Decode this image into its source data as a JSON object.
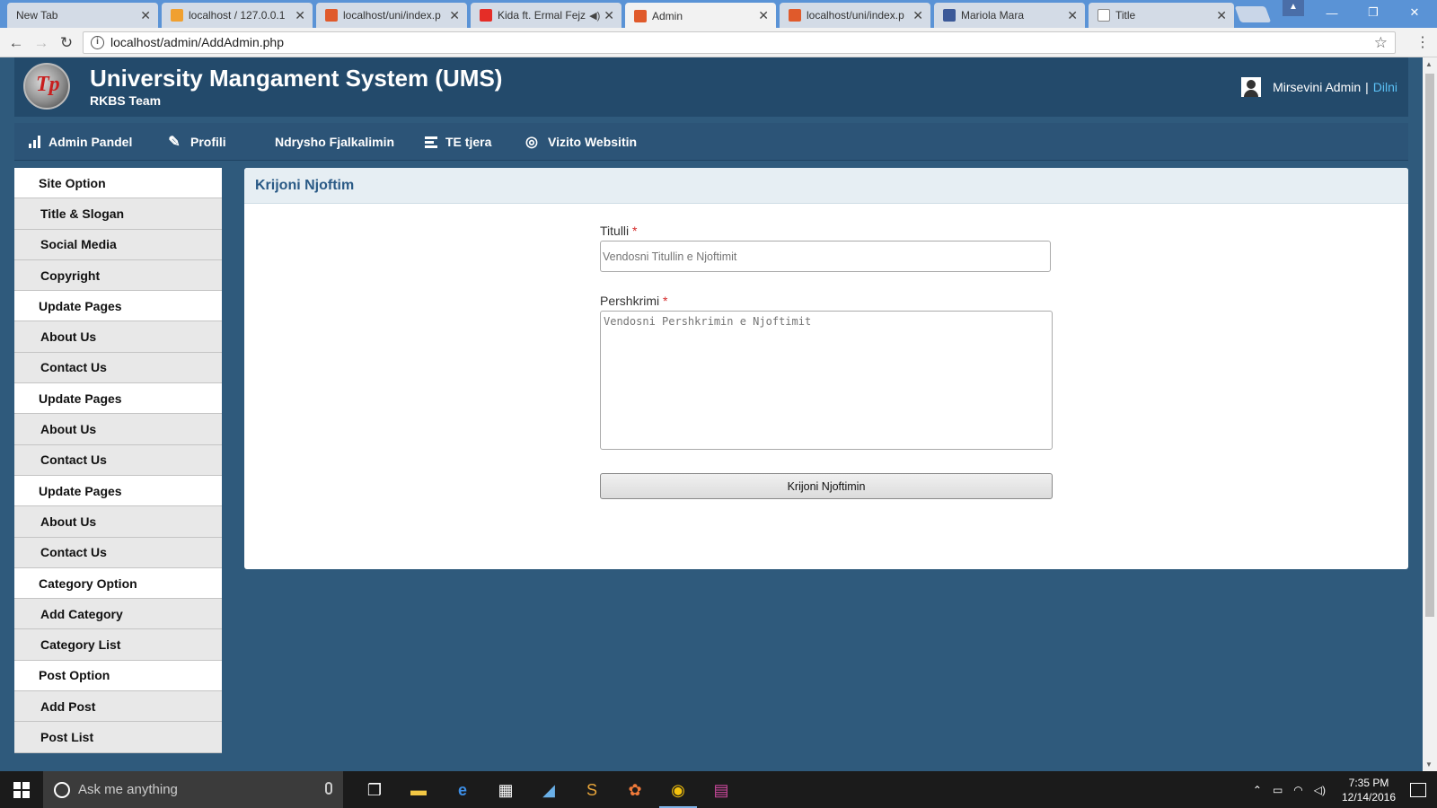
{
  "browser": {
    "tabs": [
      {
        "label": "New Tab",
        "favicon_color": "#d3dbe6",
        "active": false
      },
      {
        "label": "localhost / 127.0.0.1",
        "favicon_color": "#f0a030",
        "active": false
      },
      {
        "label": "localhost/uni/index.p",
        "favicon_color": "#e05a2b",
        "active": false
      },
      {
        "label": "Kida ft. Ermal Fejz",
        "favicon_color": "#e52d27",
        "active": false
      },
      {
        "label": "Admin",
        "favicon_color": "#e05a2b",
        "active": true
      },
      {
        "label": "localhost/uni/index.p",
        "favicon_color": "#e05a2b",
        "active": false
      },
      {
        "label": "Mariola Mara",
        "favicon_color": "#3b5998",
        "active": false
      },
      {
        "label": "Title",
        "favicon_color": "#ffffff",
        "active": false
      }
    ],
    "url": "localhost/admin/AddAdmin.php"
  },
  "header": {
    "title": "University Mangament System (UMS)",
    "subtitle": "RKBS Team",
    "greeting": "Mirsevini Admin",
    "separator": "|",
    "logout": "Dilni"
  },
  "topnav": {
    "items": [
      {
        "label": "Admin Pandel",
        "icon": "bar-chart-icon"
      },
      {
        "label": "Profili",
        "icon": "edit-icon"
      },
      {
        "label": "Ndrysho Fjalkalimin",
        "icon": "none"
      },
      {
        "label": "TE tjera",
        "icon": "list-icon"
      },
      {
        "label": "Vizito Websitin",
        "icon": "globe-icon"
      }
    ]
  },
  "sidebar": {
    "items": [
      {
        "label": "Site Option",
        "type": "header"
      },
      {
        "label": "Title & Slogan",
        "type": "link"
      },
      {
        "label": "Social Media",
        "type": "link"
      },
      {
        "label": "Copyright",
        "type": "link"
      },
      {
        "label": "Update Pages",
        "type": "header"
      },
      {
        "label": "About Us",
        "type": "link"
      },
      {
        "label": "Contact Us",
        "type": "link"
      },
      {
        "label": "Update Pages",
        "type": "header"
      },
      {
        "label": "About Us",
        "type": "link"
      },
      {
        "label": "Contact Us",
        "type": "link"
      },
      {
        "label": "Update Pages",
        "type": "header"
      },
      {
        "label": "About Us",
        "type": "link"
      },
      {
        "label": "Contact Us",
        "type": "link"
      },
      {
        "label": "Category Option",
        "type": "header"
      },
      {
        "label": "Add Category",
        "type": "link"
      },
      {
        "label": "Category List",
        "type": "link"
      },
      {
        "label": "Post Option",
        "type": "header"
      },
      {
        "label": "Add Post",
        "type": "link"
      },
      {
        "label": "Post List",
        "type": "link"
      }
    ]
  },
  "panel": {
    "title": "Krijoni Njoftim",
    "form": {
      "title_label": "Titulli",
      "title_placeholder": "Vendosni Titullin e Njoftimit",
      "desc_label": "Pershkrimi",
      "desc_placeholder": "Vendosni Pershkrimin e Njoftimit",
      "required_mark": "*",
      "submit_label": "Krijoni Njoftimin"
    }
  },
  "taskbar": {
    "search_placeholder": "Ask me anything",
    "time": "7:35 PM",
    "date": "12/14/2016"
  }
}
